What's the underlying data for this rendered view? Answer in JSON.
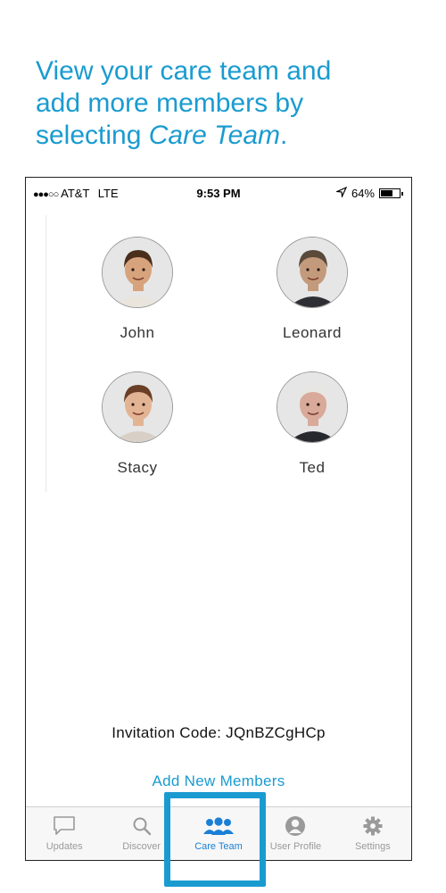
{
  "caption": {
    "line1": "View your care team and",
    "line2": "add more members by",
    "line3_prefix": "selecting ",
    "line3_em": "Care Team",
    "line3_suffix": "."
  },
  "status_bar": {
    "signal": "●●●○○",
    "carrier": "AT&T",
    "network": "LTE",
    "time": "9:53 PM",
    "battery_percent": "64%",
    "battery_level": 0.64
  },
  "members": [
    {
      "name": "John",
      "skin": "#d7a37c",
      "hair": "#4a2e1c",
      "shirt": "#e9e4dc"
    },
    {
      "name": "Leonard",
      "skin": "#c49a7c",
      "hair": "#5a4a3a",
      "shirt": "#2e2e35"
    },
    {
      "name": "Stacy",
      "skin": "#e3b494",
      "hair": "#6a3f26",
      "shirt": "#d8d0c6"
    },
    {
      "name": "Ted",
      "skin": "#d9a99a",
      "hair": "#e8e6e2",
      "shirt": "#26282e"
    }
  ],
  "invitation": {
    "label": "Invitation Code: JQnBZCgHCp"
  },
  "add_members_label": "Add New Members",
  "tabs": [
    {
      "label": "Updates",
      "icon": "chat-bubble-icon",
      "active": false
    },
    {
      "label": "Discover",
      "icon": "search-icon",
      "active": false
    },
    {
      "label": "Care Team",
      "icon": "group-icon",
      "active": true
    },
    {
      "label": "User Profile",
      "icon": "profile-icon",
      "active": false
    },
    {
      "label": "Settings",
      "icon": "gear-icon",
      "active": false
    }
  ],
  "colors": {
    "accent": "#1a9bd0",
    "tab_active": "#1a7fd6",
    "tab_inactive": "#9a9a9a"
  }
}
